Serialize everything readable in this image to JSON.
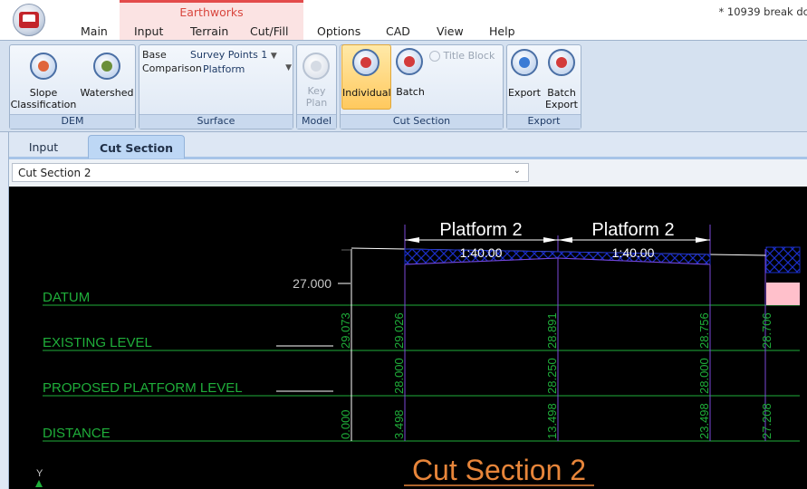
{
  "app": {
    "doc_title": "* 10939 break dc",
    "context_label": "Earthworks",
    "menu": [
      "Main",
      "Input",
      "Terrain",
      "Cut/Fill",
      "Options",
      "CAD",
      "View",
      "Help"
    ]
  },
  "ribbon": {
    "dem": {
      "title": "DEM",
      "slope": "Slope\nClassification",
      "watershed": "Watershed"
    },
    "surface": {
      "title": "Surface",
      "base_label": "Base",
      "base_value": "Survey Points 1",
      "comparison_label": "Comparison",
      "comparison_value": "Platform"
    },
    "model": {
      "title": "Model",
      "key_plan": "Key\nPlan"
    },
    "cut_section": {
      "title": "Cut Section",
      "individual": "Individual",
      "batch": "Batch",
      "title_block": "Title Block"
    },
    "export": {
      "title": "Export",
      "export": "Export",
      "batch_export": "Batch\nExport"
    }
  },
  "tabs": [
    "Input",
    "Cut Section"
  ],
  "active_tab": "Cut Section",
  "section_select": {
    "value": "Cut Section 2"
  },
  "drawing": {
    "platform_labels": [
      "Platform 2",
      "Platform 2"
    ],
    "grade_labels": [
      "1:40.00",
      "1:40.00"
    ],
    "datum_value": "27.000",
    "row_labels": [
      "DATUM",
      "EXISTING LEVEL",
      "PROPOSED PLATFORM LEVEL",
      "DISTANCE"
    ],
    "existing_levels": [
      "29.073",
      "29.026",
      "28.891",
      "28.756",
      "28.706"
    ],
    "proposed_levels": [
      "28.000",
      "28.250",
      "28.000"
    ],
    "distances": [
      "0.000",
      "3.498",
      "13.498",
      "23.498",
      "27.208"
    ],
    "title": "Cut Section 2",
    "axis_y": "Y",
    "colors": {
      "green": "#1fae3a",
      "orange": "#e7853a",
      "purple": "#7a48d9",
      "white": "#ffffff",
      "pink": "#ffc0cb",
      "hatch": "#1a2ec8"
    }
  }
}
